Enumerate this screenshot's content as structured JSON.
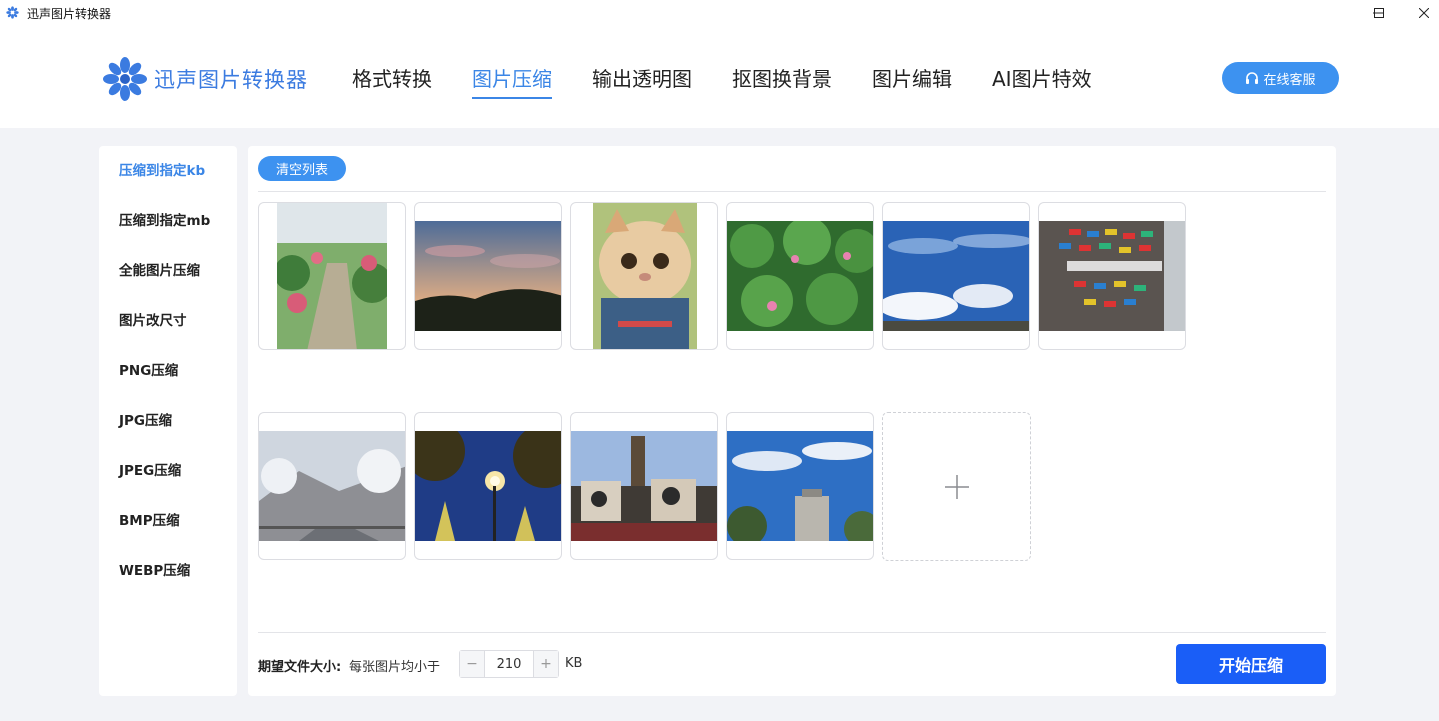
{
  "window": {
    "title": "迅声图片转换器"
  },
  "header": {
    "brand": "迅声图片转换器",
    "nav": [
      "格式转换",
      "图片压缩",
      "输出透明图",
      "抠图换背景",
      "图片编辑",
      "AI图片特效"
    ],
    "active_nav": "图片压缩",
    "support_label": "在线客服"
  },
  "sidebar": {
    "items": [
      "压缩到指定kb",
      "压缩到指定mb",
      "全能图片压缩",
      "图片改尺寸",
      "PNG压缩",
      "JPG压缩",
      "JPEG压缩",
      "BMP压缩",
      "WEBP压缩"
    ],
    "active": "压缩到指定kb"
  },
  "main": {
    "clear_label": "清空列表",
    "thumbnails": [
      {
        "name": "garden-path-photo",
        "orientation": "portrait"
      },
      {
        "name": "sunset-sky-photo",
        "orientation": "landscape"
      },
      {
        "name": "exotic-cat-photo",
        "orientation": "portrait"
      },
      {
        "name": "lotus-pond-photo",
        "orientation": "landscape"
      },
      {
        "name": "blue-sky-clouds-photo",
        "orientation": "landscape"
      },
      {
        "name": "sign-wall-photo",
        "orientation": "landscape"
      },
      {
        "name": "snowy-road-photo",
        "orientation": "landscape"
      },
      {
        "name": "night-street-lamp-photo",
        "orientation": "landscape"
      },
      {
        "name": "clock-tower-building-photo",
        "orientation": "landscape"
      },
      {
        "name": "tower-under-sky-photo",
        "orientation": "landscape"
      }
    ],
    "add_icon": "plus-icon"
  },
  "footer": {
    "size_label": "期望文件大小:",
    "size_desc": "每张图片均小于",
    "value": "210",
    "unit": "KB",
    "start_label": "开始压缩"
  },
  "colors": {
    "accent": "#3d92f0",
    "primary_button": "#1a5ef7",
    "background": "#f2f3f7"
  }
}
